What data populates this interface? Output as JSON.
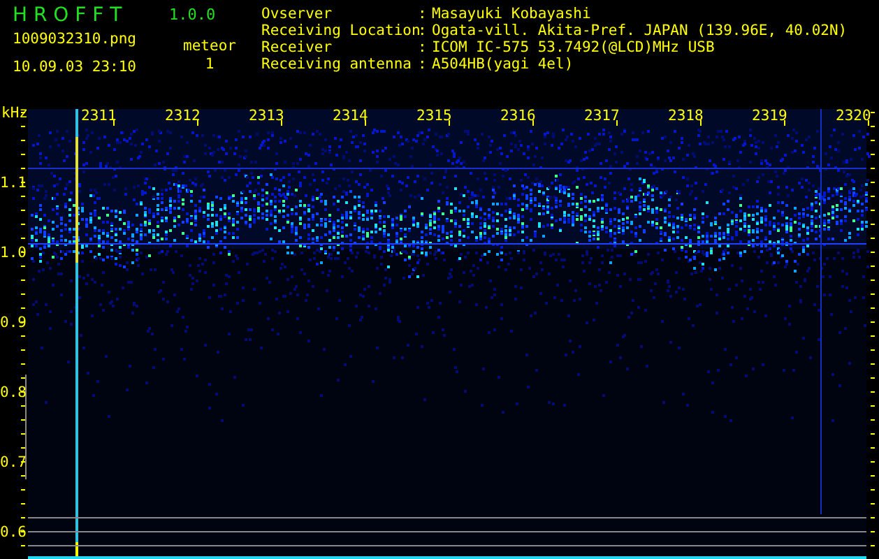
{
  "app": {
    "title": "H R O F F T",
    "version": "1.0.0"
  },
  "file": {
    "name": "1009032310.png",
    "datetime": "10.09.03 23:10"
  },
  "count": {
    "label": "meteor",
    "value": "1"
  },
  "station": [
    {
      "label": "Ovserver",
      "colon": ":",
      "value": "Masayuki Kobayashi"
    },
    {
      "label": "Receiving Location",
      "colon": ":",
      "value": "Ogata-vill. Akita-Pref. JAPAN (139.96E, 40.02N)"
    },
    {
      "label": "Receiver",
      "colon": ":",
      "value": "ICOM IC-575 53.7492(@LCD)MHz USB"
    },
    {
      "label": "Receiving antenna",
      "colon": ":",
      "value": "A504HB(yagi 4el)"
    }
  ],
  "spectrogram": {
    "y_unit": "kHz",
    "y_labels": [
      "1.1",
      "1.0",
      "0.9",
      "0.8",
      "0.7",
      "0.6"
    ],
    "x_labels": [
      "2311",
      "2312",
      "2313",
      "2314",
      "2315",
      "2316",
      "2317",
      "2318",
      "2319",
      "2320"
    ]
  }
}
